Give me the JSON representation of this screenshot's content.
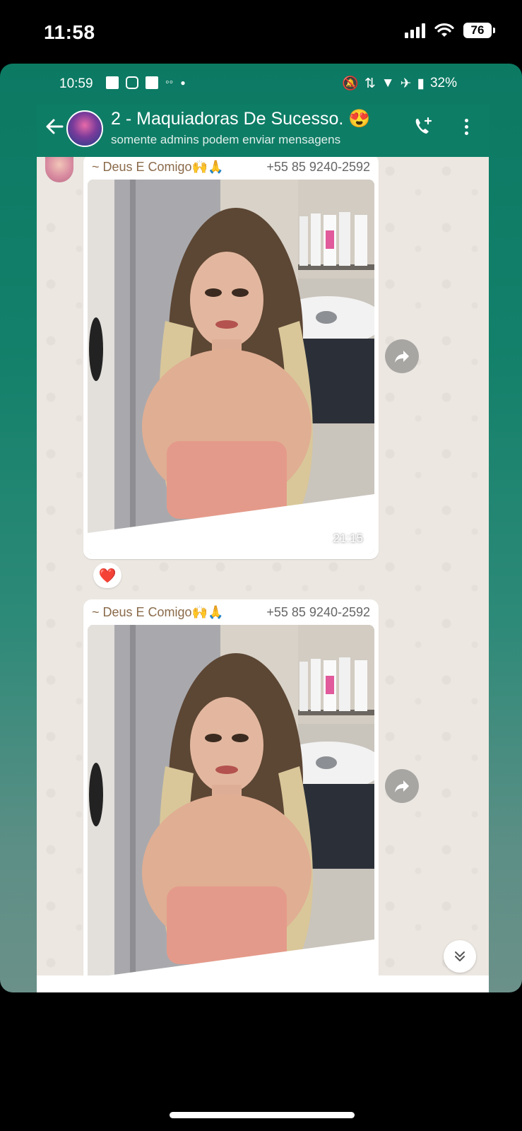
{
  "ios_status": {
    "time": "11:58",
    "battery": "76"
  },
  "android_status": {
    "time": "10:59",
    "battery": "32%"
  },
  "header": {
    "title": "2 - Maquiadoras De Sucesso. 😍",
    "subtitle": "somente admins podem enviar mensagens"
  },
  "messages": [
    {
      "sender": "~ Deus E Comigo🙌🙏",
      "phone": "+55 85 9240-2592",
      "time": "21:15",
      "reaction": "❤️"
    },
    {
      "sender": "~ Deus E Comigo🙌🙏",
      "phone": "+55 85 9240-2592"
    }
  ],
  "colors": {
    "header": "#0e7d66",
    "chat_bg": "#ece7e1",
    "sender_name": "#8a6a4a"
  }
}
